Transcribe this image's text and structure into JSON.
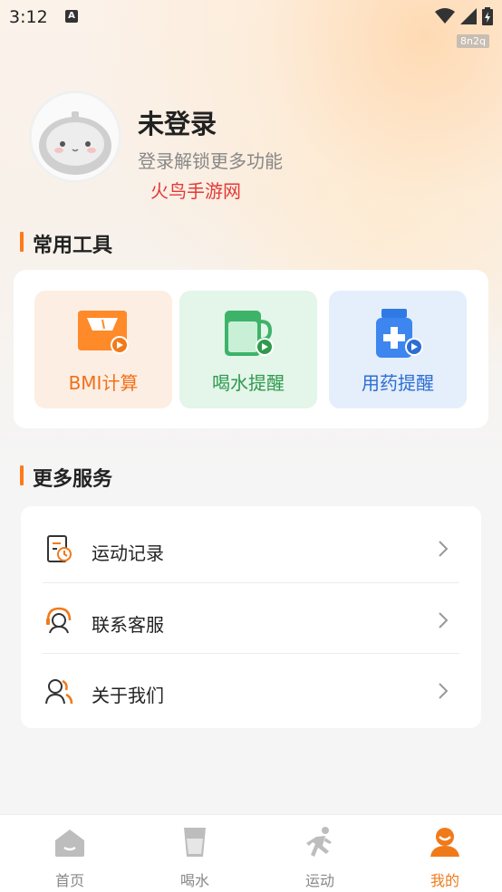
{
  "status_bar": {
    "time": "3:12",
    "a_icon": "A",
    "watermark": "8n2q"
  },
  "profile": {
    "name": "未登录",
    "hint": "登录解锁更多功能",
    "site_tag": "火鸟手游网"
  },
  "tools_section": {
    "title": "常用工具",
    "items": [
      {
        "label": "BMI计算",
        "icon": "scale-icon",
        "color": "#f0701a"
      },
      {
        "label": "喝水提醒",
        "icon": "water-cup-icon",
        "color": "#2f9a4e"
      },
      {
        "label": "用药提醒",
        "icon": "medicine-bottle-icon",
        "color": "#2c6ed3"
      }
    ]
  },
  "services_section": {
    "title": "更多服务",
    "items": [
      {
        "label": "运动记录",
        "icon": "exercise-record-icon"
      },
      {
        "label": "联系客服",
        "icon": "customer-service-icon"
      },
      {
        "label": "关于我们",
        "icon": "about-us-icon"
      }
    ]
  },
  "bottom_nav": {
    "items": [
      {
        "label": "首页",
        "icon": "home-icon"
      },
      {
        "label": "喝水",
        "icon": "water-icon"
      },
      {
        "label": "运动",
        "icon": "running-icon"
      },
      {
        "label": "我的",
        "icon": "profile-icon",
        "active": true
      }
    ]
  },
  "colors": {
    "accent": "#f07a1a",
    "red_tag": "#e53935"
  }
}
